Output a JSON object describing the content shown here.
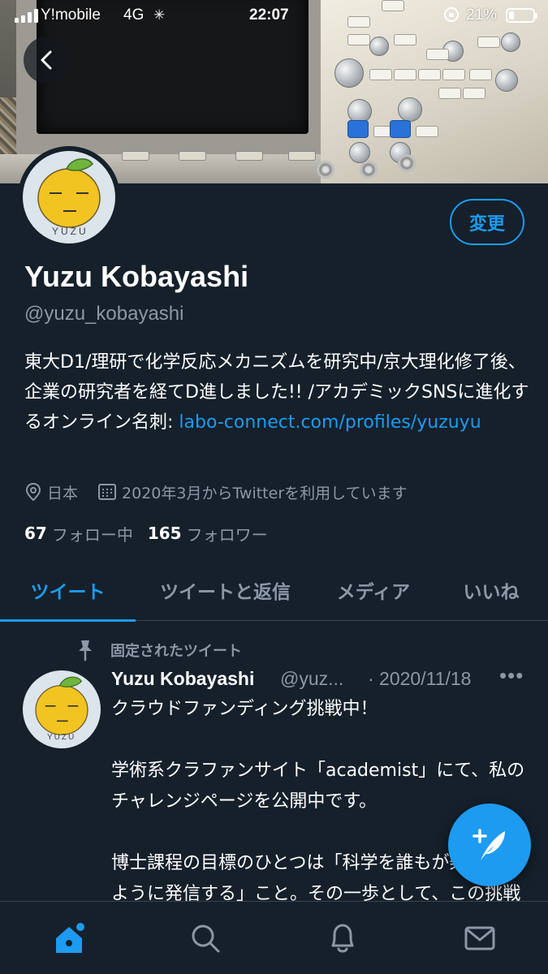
{
  "status_bar": {
    "carrier": "Y!mobile",
    "network": "4G",
    "time": "22:07",
    "battery": "21%"
  },
  "profile": {
    "display_name": "Yuzu Kobayashi",
    "handle": "@yuzu_kobayashi",
    "edit_label": "変更",
    "bio_text": "東大D1/理研で化学反応メカニズムを研究中/京大理化修了後、企業の研究者を経てD進しました!! /アカデミックSNSに進化するオンライン名刺: ",
    "bio_link": "labo-connect.com/profiles/yuzuyu",
    "location": "日本",
    "joined": "2020年3月からTwitterを利用しています",
    "following_count": "67",
    "following_label": "フォロー中",
    "followers_count": "165",
    "followers_label": "フォロワー",
    "avatar_text": "YUZU"
  },
  "tabs": [
    {
      "label": "ツイート",
      "active": true
    },
    {
      "label": "ツイートと返信",
      "active": false
    },
    {
      "label": "メディア",
      "active": false
    },
    {
      "label": "いいね",
      "active": false
    }
  ],
  "pinned_tweet": {
    "pinned_label": "固定されたツイート",
    "author_name": "Yuzu Kobayashi",
    "author_handle": "@yuz...",
    "date": "· 2020/11/18",
    "more": "•••",
    "text": "クラウドファンディング挑戦中！\n\n学術系クラファンサイト「academist」にて、私のチャレンジページを公開中です。\n\n博士課程の目標のひとつは「科学を誰もが楽しめるように発信する」こと。その一歩として、この挑戦を成功させたい！"
  },
  "icons": {
    "back": "back-arrow-icon",
    "location": "location-pin-icon",
    "calendar": "calendar-icon",
    "pin": "pin-icon",
    "compose": "compose-tweet-icon",
    "home": "home-icon",
    "search": "search-icon",
    "notifications": "bell-icon",
    "messages": "mail-icon"
  },
  "colors": {
    "background": "#15202b",
    "accent": "#1d9bf0",
    "secondary_text": "#8b98a5",
    "divider": "#38444d"
  }
}
